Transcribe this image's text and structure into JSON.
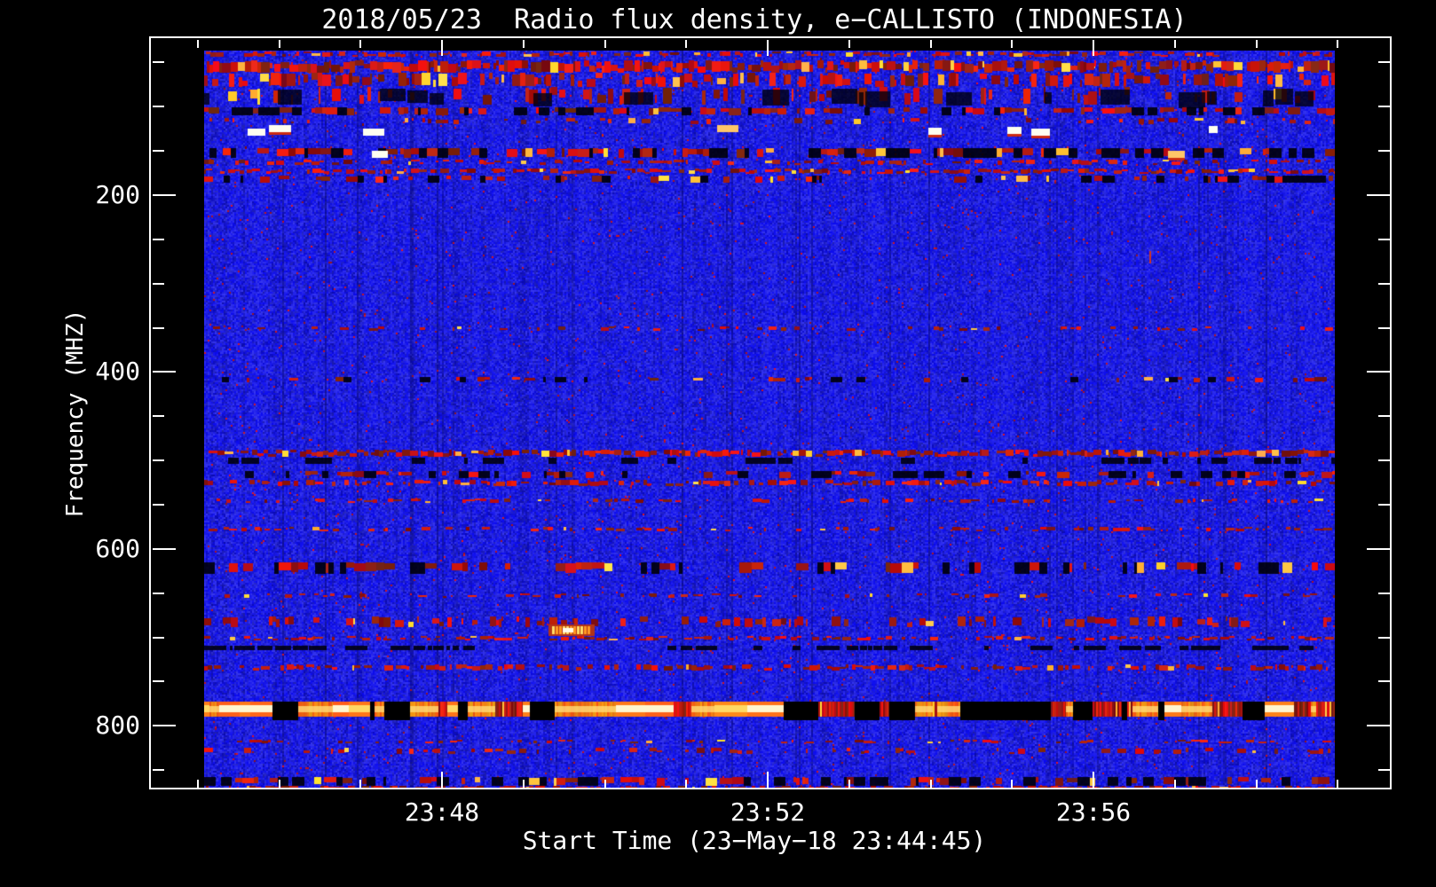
{
  "chart_data": {
    "type": "heatmap",
    "subtype": "radio-spectrogram",
    "title": "2018/05/23  Radio flux density, e−CALLISTO (INDONESIA)",
    "xlabel": "Start Time (23−May−18 23:44:45)",
    "ylabel": "Frequency (MHZ)",
    "x_ticks_major": [
      {
        "label": "23:48",
        "minute": 48
      },
      {
        "label": "23:52",
        "minute": 52
      },
      {
        "label": "23:56",
        "minute": 56
      }
    ],
    "x_minor_interval_s": 60,
    "x_minor_minutes": [
      45,
      46,
      47,
      49,
      50,
      51,
      53,
      54,
      55,
      57,
      58,
      59
    ],
    "x_axis_time_range": [
      "23:44:26",
      "23:59:40"
    ],
    "data_time_range": [
      "23:45:05",
      "23:58:58"
    ],
    "y_ticks_major": [
      200,
      400,
      600,
      800
    ],
    "y_minor_interval_mhz": 50,
    "y_axis_range_mhz": [
      23,
      872
    ],
    "data_freq_range_mhz": [
      35,
      872
    ],
    "y_axis_inverted": true,
    "grid": false,
    "legend": "none",
    "colors": {
      "figure_background": "#000000",
      "axis_and_text": "#ffffff",
      "quiet_background_blue": "#2323d2",
      "rfi_red": "#cc2200",
      "rfi_orange": "#ff8822",
      "rfi_bright": "#fff8d8",
      "rfi_black": "#000000"
    },
    "rfi_bands": [
      {
        "f": [
          35,
          186
        ],
        "type": "mixed",
        "density": 0.05
      },
      {
        "f": [
          38,
          44
        ],
        "type": "red",
        "density": 0.5
      },
      {
        "f": [
          48,
          62
        ],
        "type": "red",
        "density": 0.85
      },
      {
        "f": [
          62,
          78
        ],
        "type": "red",
        "density": 0.45
      },
      {
        "f": [
          78,
          98
        ],
        "type": "red",
        "density": 0.22
      },
      {
        "f": [
          80,
          98
        ],
        "type": "bars_dark",
        "density": 0.25
      },
      {
        "f": [
          101,
          110
        ],
        "type": "red_dark",
        "density": 0.65
      },
      {
        "f": [
          113,
          120
        ],
        "type": "red",
        "density": 0.15
      },
      {
        "f": [
          121,
          134
        ],
        "type": "white_dash",
        "density": 0.05
      },
      {
        "f": [
          147,
          158
        ],
        "type": "red_dark",
        "density": 0.7
      },
      {
        "f": [
          150,
          156
        ],
        "type": "white_dash",
        "density": 0.015
      },
      {
        "f": [
          160,
          166
        ],
        "type": "red",
        "density": 0.3
      },
      {
        "f": [
          170,
          176
        ],
        "type": "red",
        "density": 0.6
      },
      {
        "f": [
          178,
          186
        ],
        "type": "red_dark",
        "density": 0.5
      },
      {
        "f": [
          348,
          353
        ],
        "type": "red",
        "density": 0.2
      },
      {
        "f": [
          406,
          412
        ],
        "type": "red_dark",
        "density": 0.22
      },
      {
        "f": [
          488,
          496
        ],
        "type": "red",
        "density": 0.8
      },
      {
        "f": [
          497,
          504
        ],
        "type": "dark",
        "density": 0.4
      },
      {
        "f": [
          512,
          520
        ],
        "type": "red_dark",
        "density": 0.45
      },
      {
        "f": [
          522,
          529
        ],
        "type": "red",
        "density": 0.4
      },
      {
        "f": [
          543,
          548
        ],
        "type": "red",
        "density": 0.22
      },
      {
        "f": [
          575,
          580
        ],
        "type": "red",
        "density": 0.22
      },
      {
        "f": [
          615,
          628
        ],
        "type": "red_dark",
        "density": 0.5
      },
      {
        "f": [
          650,
          655
        ],
        "type": "red",
        "density": 0.18
      },
      {
        "f": [
          676,
          688
        ],
        "type": "red",
        "density": 0.35
      },
      {
        "f": [
          698,
          704
        ],
        "type": "red",
        "density": 0.45
      },
      {
        "f": [
          710,
          715
        ],
        "type": "dark",
        "density": 0.45
      },
      {
        "f": [
          731,
          738
        ],
        "type": "red",
        "density": 0.45
      },
      {
        "f": [
          773,
          790
        ],
        "type": "bright_band",
        "density": 1.0
      },
      {
        "f": [
          816,
          820
        ],
        "type": "red",
        "density": 0.2
      },
      {
        "f": [
          825,
          832
        ],
        "type": "red",
        "density": 0.18
      },
      {
        "f": [
          858,
          868
        ],
        "type": "red_dark",
        "density": 0.6
      },
      {
        "f": [
          868,
          872
        ],
        "type": "red",
        "density": 0.4
      }
    ],
    "features": [
      {
        "type": "blob",
        "t_frac": 0.323,
        "f": [
          687,
          696
        ],
        "note": "bright orange-yellow burst patch"
      },
      {
        "type": "spike",
        "t_frac": 0.836,
        "f": [
          263,
          277
        ],
        "note": "thin vertical red spike"
      }
    ]
  }
}
